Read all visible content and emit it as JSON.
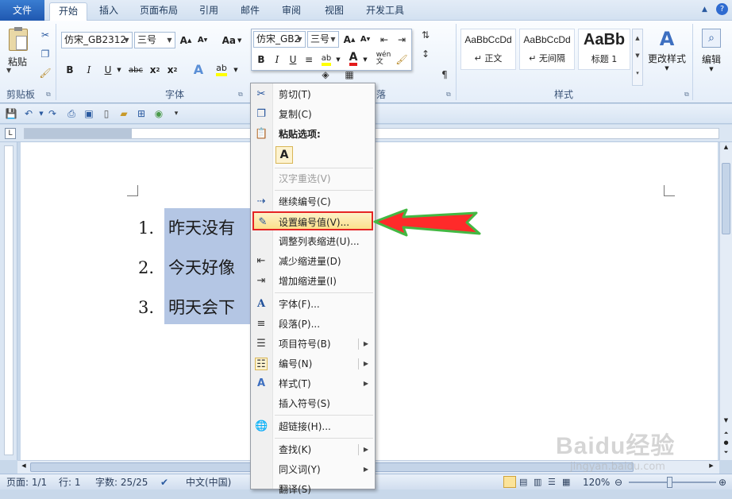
{
  "tabs": [
    "文件",
    "开始",
    "插入",
    "页面布局",
    "引用",
    "邮件",
    "审阅",
    "视图",
    "开发工具"
  ],
  "ribbon": {
    "paste_label": "粘贴",
    "font_name": "仿宋_GB2312",
    "font_size": "三号",
    "aa_label": "Aa",
    "group_clipboard": "剪贴板",
    "group_font": "字体",
    "group_paragraph": "落",
    "group_styles": "样式",
    "group_edit": "编辑",
    "styles": [
      {
        "sample": "AaBbCcDd",
        "name": "↵ 正文"
      },
      {
        "sample": "AaBbCcDd",
        "name": "↵ 无间隔"
      },
      {
        "sample": "AaBb",
        "name": "标题 1"
      }
    ],
    "change_styles": "更改样式",
    "edit_label": "编辑"
  },
  "mini_toolbar": {
    "font_name": "仿宋_GB2",
    "font_size": "三号"
  },
  "document": {
    "list": [
      {
        "num": "1.",
        "text": "昨天没有"
      },
      {
        "num": "2.",
        "text": "今天好像"
      },
      {
        "num": "3.",
        "text": "明天会下"
      }
    ]
  },
  "context_menu": {
    "items": [
      {
        "label": "剪切(T)",
        "icon": "scissors-icon",
        "glyph": "✂"
      },
      {
        "label": "复制(C)",
        "icon": "copy-icon",
        "glyph": "❐"
      },
      {
        "label": "粘贴选项:",
        "icon": "paste-icon",
        "glyph": "📋"
      },
      {
        "label": "汉字重选(V)",
        "icon": "",
        "glyph": ""
      },
      {
        "label": "继续编号(C)",
        "icon": "continue-numbering-icon",
        "glyph": "⇢"
      },
      {
        "label": "设置编号值(V)...",
        "icon": "set-number-icon",
        "glyph": "✎"
      },
      {
        "label": "调整列表缩进(U)...",
        "icon": "",
        "glyph": ""
      },
      {
        "label": "减少缩进量(D)",
        "icon": "decrease-indent-icon",
        "glyph": "⇤"
      },
      {
        "label": "增加缩进量(I)",
        "icon": "increase-indent-icon",
        "glyph": "⇥"
      },
      {
        "label": "字体(F)...",
        "icon": "font-icon",
        "glyph": "A"
      },
      {
        "label": "段落(P)...",
        "icon": "paragraph-icon",
        "glyph": "≡"
      },
      {
        "label": "项目符号(B)",
        "icon": "bullets-icon",
        "glyph": "☰"
      },
      {
        "label": "编号(N)",
        "icon": "numbering-icon",
        "glyph": "☷"
      },
      {
        "label": "样式(T)",
        "icon": "styles-icon",
        "glyph": "A"
      },
      {
        "label": "插入符号(S)",
        "icon": "",
        "glyph": ""
      },
      {
        "label": "超链接(H)...",
        "icon": "hyperlink-icon",
        "glyph": "🌐"
      },
      {
        "label": "查找(K)",
        "icon": "",
        "glyph": ""
      },
      {
        "label": "同义词(Y)",
        "icon": "",
        "glyph": ""
      },
      {
        "label": "翻译(S)",
        "icon": "",
        "glyph": ""
      }
    ],
    "paste_keep_text": "A"
  },
  "status": {
    "page": "页面: 1/1",
    "line": "行: 1",
    "words": "字数: 25/25",
    "lang": "中文(中国)",
    "zoom": "120%"
  },
  "watermark": {
    "brand": "Baidu经验",
    "site": "jingyan.baidu.com"
  },
  "colors": {
    "highlight_border": "#e52424",
    "arrow": "#ff2a2a",
    "selection": "#b4c6e4",
    "file_tab": "#2b64bf"
  }
}
